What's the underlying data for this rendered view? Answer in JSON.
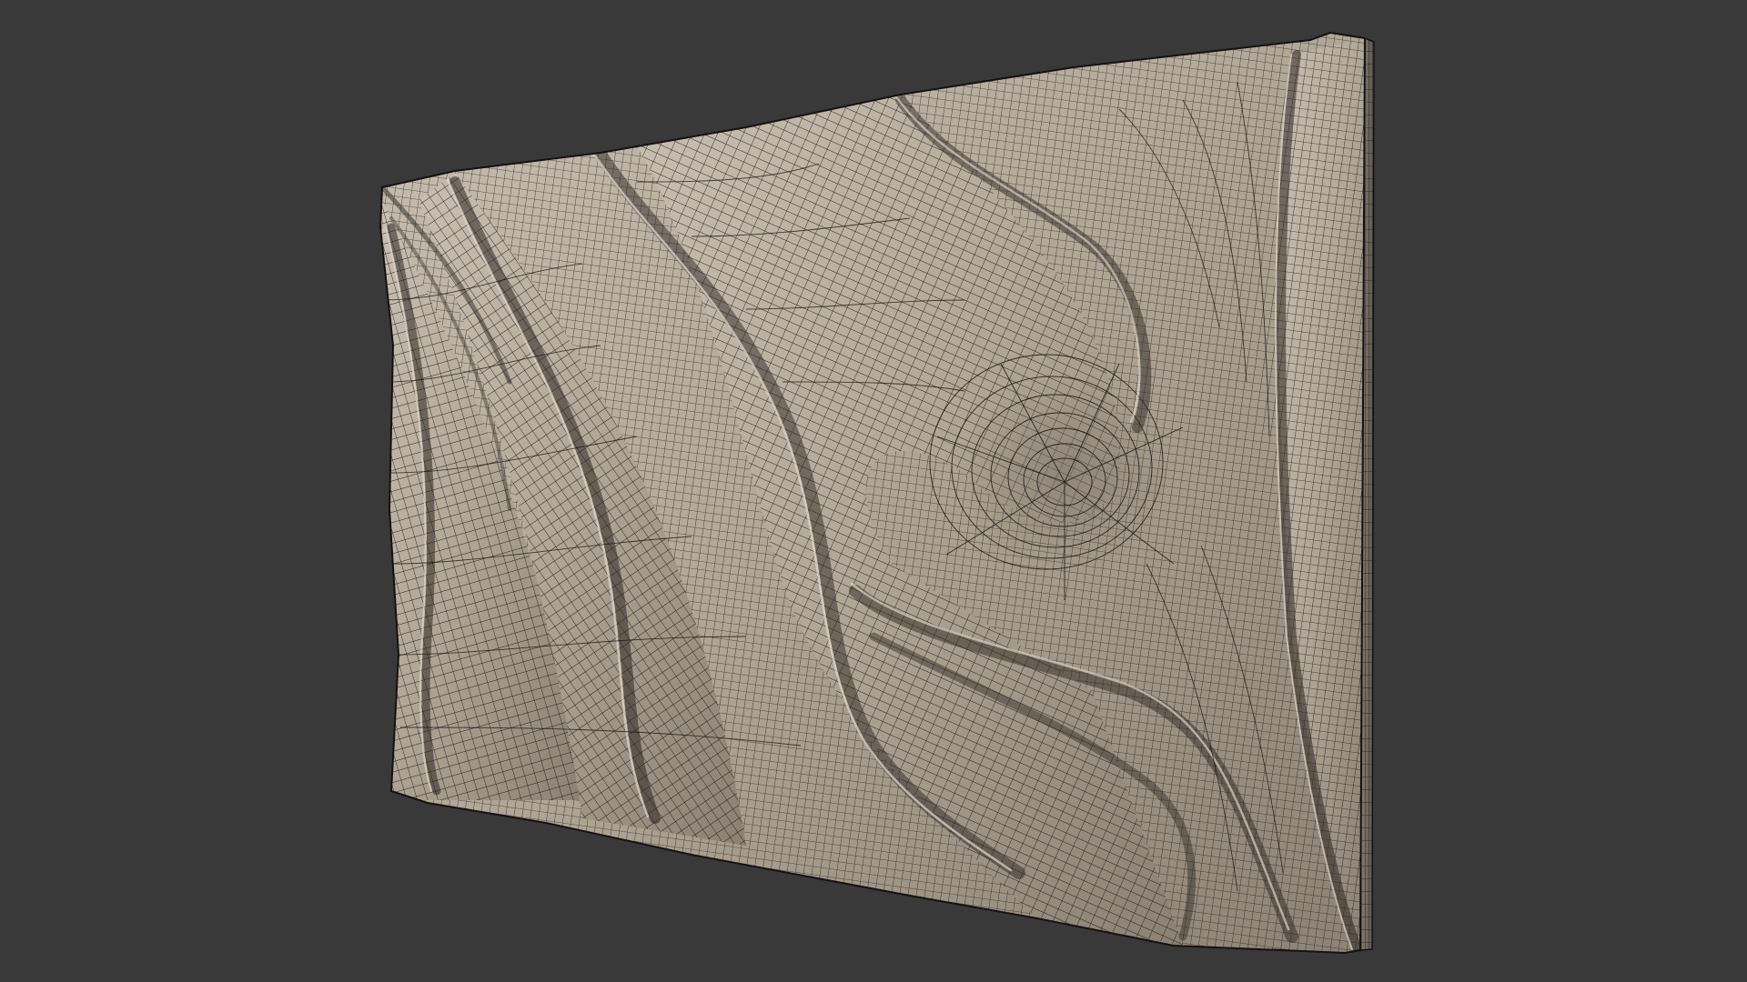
{
  "viewport": {
    "background_color": "#393939",
    "surface_color": "#b2a89a",
    "wire_color": "#141210"
  }
}
